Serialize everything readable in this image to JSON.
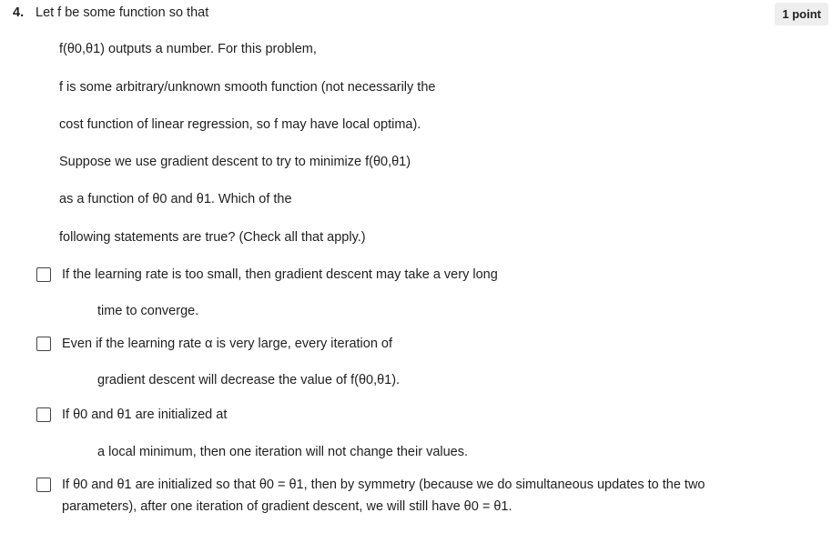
{
  "question": {
    "number": "4.",
    "header": "Let f be some function so that",
    "points_badge": "1 point",
    "stem": [
      "f(θ0,θ1) outputs a number. For this problem,",
      "f is some arbitrary/unknown smooth function (not necessarily the",
      "cost function of linear regression, so f may have local optima).",
      "Suppose we use gradient descent to try to minimize f(θ0,θ1)",
      "as a function of θ0 and θ1. Which of the",
      "following statements are true? (Check all that apply.)"
    ]
  },
  "options": [
    {
      "checked": false,
      "line1": "If the learning rate is too small, then gradient descent may take a very long",
      "line2": "time to converge."
    },
    {
      "checked": false,
      "line1": "Even if the learning rate α is very large, every iteration of",
      "line2": "gradient descent will decrease the value of f(θ0,θ1)."
    },
    {
      "checked": false,
      "line1": "If θ0 and θ1 are initialized at",
      "line2": "a local minimum, then one iteration will not change their values."
    },
    {
      "checked": false,
      "text": "If θ0 and θ1 are initialized so that θ0 = θ1, then by symmetry (because we do simultaneous updates to the two parameters), after one iteration of gradient descent, we will still have θ0 = θ1."
    }
  ]
}
